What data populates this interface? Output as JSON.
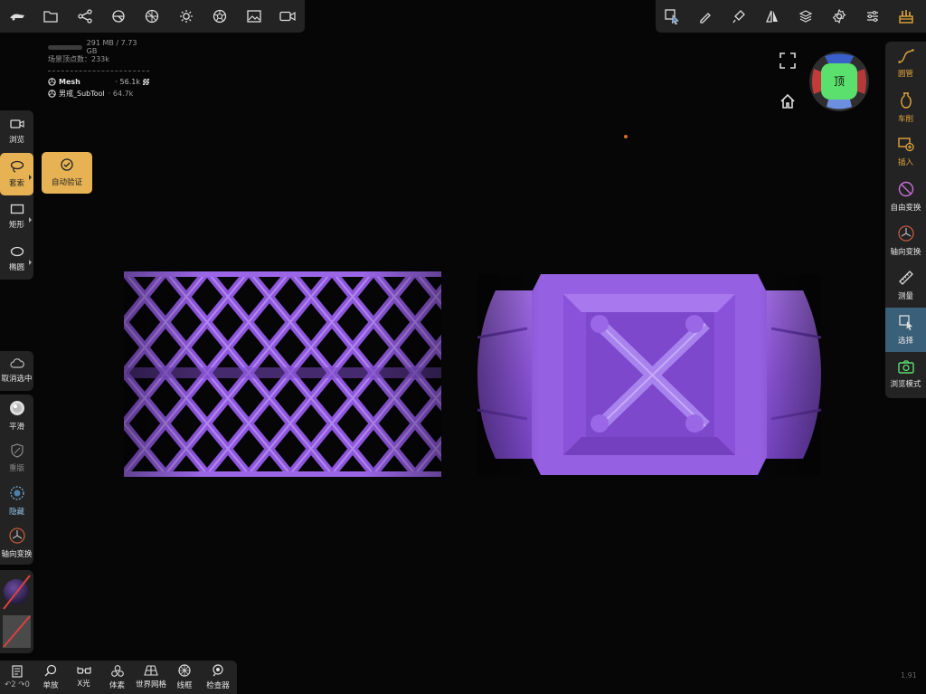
{
  "stats": {
    "memory": "291 MB / 7.73 GB",
    "vertices_label": "场景顶点数：233k",
    "meshes": [
      {
        "name": "Mesh",
        "count": "· 56.1k"
      },
      {
        "name": "男戒_SubTool",
        "count": "· 64.7k"
      }
    ]
  },
  "left_tools": [
    {
      "label": "浏览"
    },
    {
      "label": "套索"
    },
    {
      "label": "矩形"
    },
    {
      "label": "椭圆"
    }
  ],
  "popup": {
    "label": "自动验证"
  },
  "left_actions": [
    {
      "label": "取消选中"
    },
    {
      "label": "平滑"
    },
    {
      "label": "重版"
    },
    {
      "label": "隐藏"
    },
    {
      "label": "轴向变换"
    }
  ],
  "right_tools": [
    {
      "label": "圆管"
    },
    {
      "label": "车削"
    },
    {
      "label": "插入"
    },
    {
      "label": "自由变换"
    },
    {
      "label": "轴向变换"
    },
    {
      "label": "测量"
    },
    {
      "label": "选择"
    },
    {
      "label": "浏览模式"
    }
  ],
  "bottom_tools": [
    {
      "label": "↶2 ↷0"
    },
    {
      "label": "单放"
    },
    {
      "label": "X光"
    },
    {
      "label": "体素"
    },
    {
      "label": "世界网格"
    },
    {
      "label": "线框"
    },
    {
      "label": "检查器"
    }
  ],
  "gizmo": {
    "face_label": "顶"
  },
  "version": "1.91",
  "colors": {
    "accent": "#e0a63c",
    "mesh": "#8e56dc",
    "selected": "#3a5f78"
  }
}
